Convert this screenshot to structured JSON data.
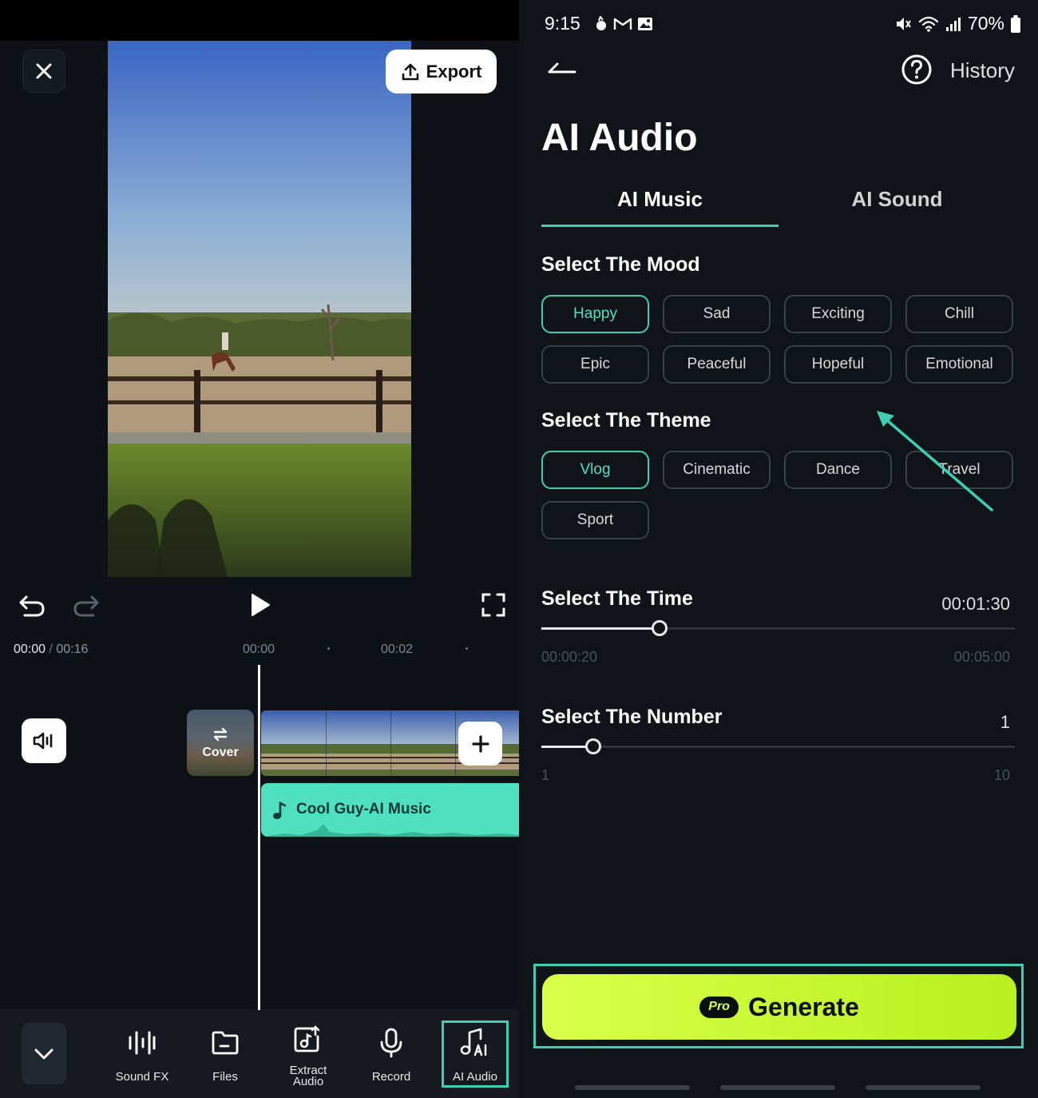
{
  "left": {
    "export_label": "Export",
    "time_current": "00:00",
    "time_separator": " / ",
    "time_total": "00:16",
    "ticks": [
      "00:00",
      "00:02"
    ],
    "cover_label": "Cover",
    "music_track": "Cool Guy-AI Music",
    "nav": [
      {
        "label": "Sound FX",
        "icon": "sound-fx-icon"
      },
      {
        "label": "Files",
        "icon": "folder-icon"
      },
      {
        "label": "Extract\nAudio",
        "icon": "extract-audio-icon"
      },
      {
        "label": "Record",
        "icon": "microphone-icon"
      },
      {
        "label": "AI Audio",
        "icon": "ai-audio-icon",
        "active": true
      }
    ]
  },
  "right": {
    "status": {
      "time": "9:15",
      "battery": "70%"
    },
    "history_label": "History",
    "title": "AI Audio",
    "tabs": [
      {
        "label": "AI Music",
        "active": true
      },
      {
        "label": "AI Sound",
        "active": false
      }
    ],
    "mood": {
      "title": "Select The Mood",
      "options": [
        "Happy",
        "Sad",
        "Exciting",
        "Chill",
        "Epic",
        "Peaceful",
        "Hopeful",
        "Emotional"
      ],
      "selected": "Happy"
    },
    "theme": {
      "title": "Select The Theme",
      "options": [
        "Vlog",
        "Cinematic",
        "Dance",
        "Travel",
        "Sport"
      ],
      "selected": "Vlog"
    },
    "time": {
      "title": "Select The Time",
      "value": "00:01:30",
      "min": "00:00:20",
      "max": "00:05:00",
      "fraction": 0.25
    },
    "number": {
      "title": "Select The Number",
      "value": "1",
      "min": "1",
      "max": "10",
      "fraction": 0.11
    },
    "generate": {
      "badge": "Pro",
      "label": "Generate"
    },
    "colors": {
      "accent": "#3ecfb2",
      "generate": "#c8f833"
    }
  }
}
